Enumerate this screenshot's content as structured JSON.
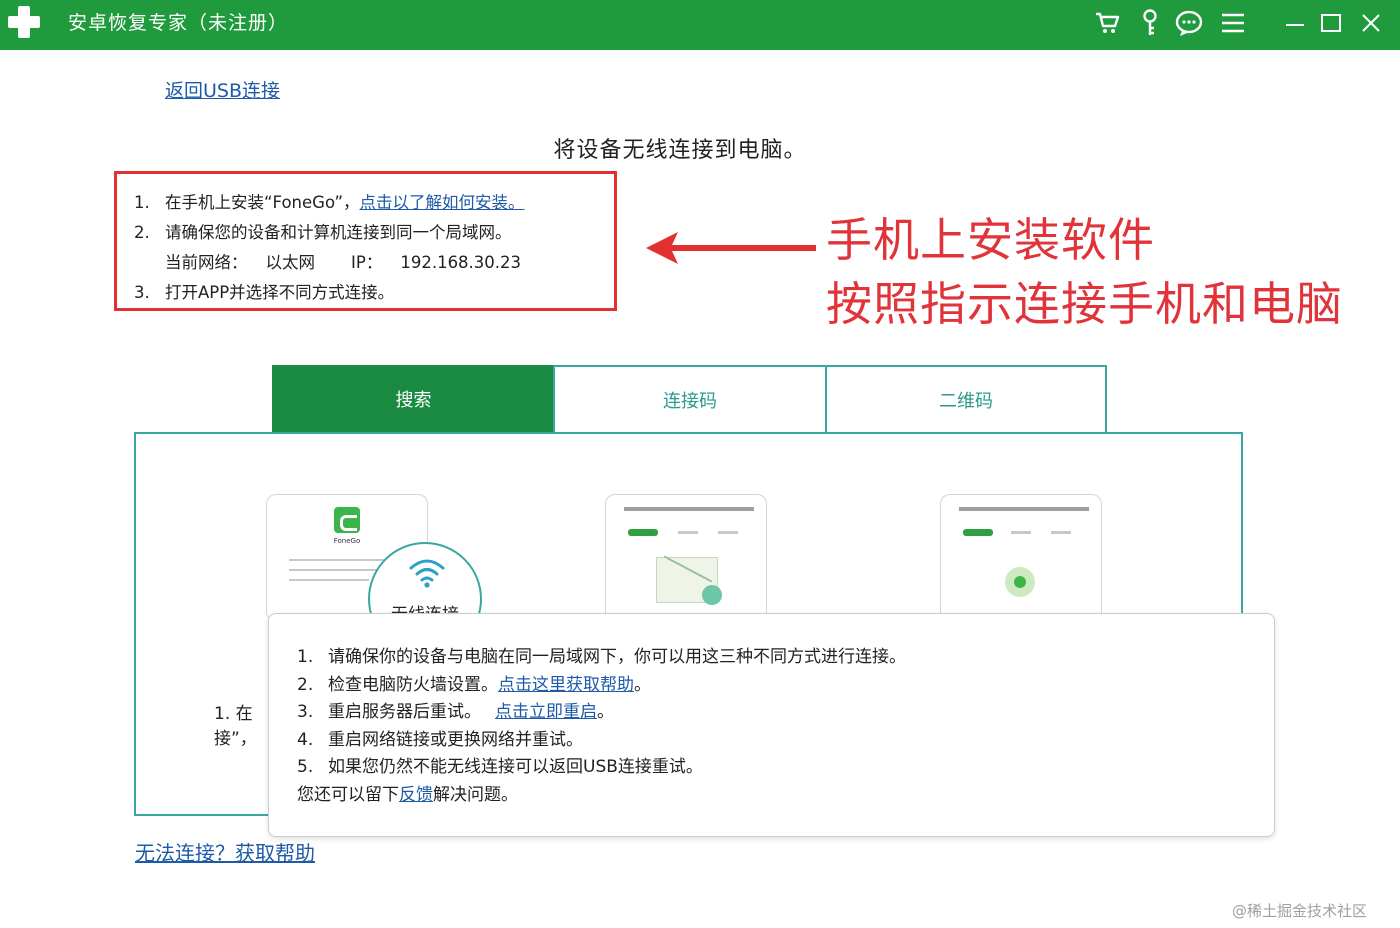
{
  "titlebar": {
    "title": "安卓恢复专家（未注册）",
    "icons": [
      "cart-icon",
      "key-icon",
      "chat-icon",
      "menu-icon",
      "minimize-icon",
      "maximize-icon",
      "close-icon"
    ]
  },
  "back_link": "返回USB连接",
  "heading": "将设备无线连接到电脑。",
  "instructions": {
    "item1_num": "1.",
    "item1_text": "在手机上安装“FoneGo”，",
    "item1_link": "点击以了解如何安装。",
    "item2_num": "2.",
    "item2_text": "请确保您的设备和计算机连接到同一个局域网。",
    "network_label": "当前网络：",
    "network_value": "以太网",
    "ip_label": "IP：",
    "ip_value": "192.168.30.23",
    "item3_num": "3.",
    "item3_text": "打开APP并选择不同方式连接。"
  },
  "annotation": {
    "line1": "手机上安装软件",
    "line2": "按照指示连接手机和电脑",
    "color": "#e0333a"
  },
  "tabs": {
    "search": "搜索",
    "code": "连接码",
    "qr": "二维码"
  },
  "cards": {
    "app_name": "FoneGo",
    "wifi_label": "无线连接"
  },
  "behind_text": {
    "line1": "1.  在",
    "line2": "接”，"
  },
  "popup": {
    "item1_num": "1.",
    "item1": "请确保你的设备与电脑在同一局域网下，你可以用这三种不同方式进行连接。",
    "item2_num": "2.",
    "item2_text": "检查电脑防火墙设置。",
    "item2_link": "点击这里获取帮助",
    "item2_end": "。",
    "item3_num": "3.",
    "item3_text": "重启服务器后重试。",
    "item3_link": "点击立即重启",
    "item3_end": "。",
    "item4_num": "4.",
    "item4": "重启网络链接或更换网络并重试。",
    "item5_num": "5.",
    "item5": "如果您仍然不能无线连接可以返回USB连接重试。",
    "footer_pre": "您还可以留下",
    "footer_link": "反馈",
    "footer_post": "解决问题。"
  },
  "help_link": "无法连接？获取帮助",
  "watermark": "@稀土掘金技术社区",
  "colors": {
    "titlebar": "#1f9a3d",
    "active_tab": "#1a8a42",
    "accent_border": "#3aa8a0",
    "link": "#1e5aa8",
    "highlight_box": "#e03030"
  }
}
